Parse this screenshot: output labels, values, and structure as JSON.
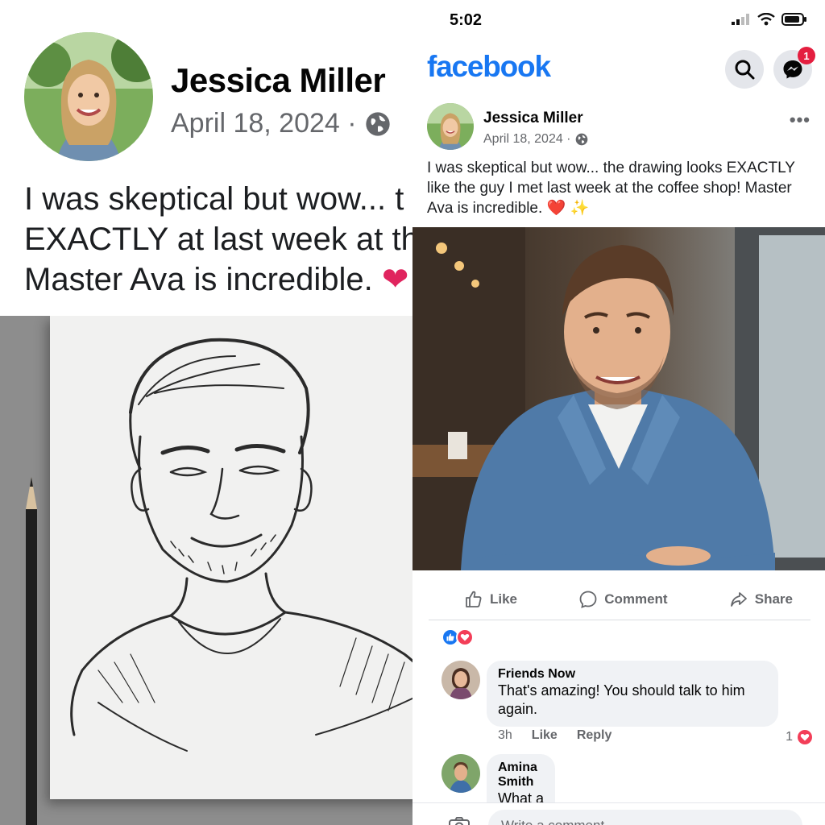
{
  "left_post": {
    "author": "Jessica Miller",
    "date": "April 18, 2024 ·",
    "text_lines": [
      "I was skeptical but wow... t",
      "EXACTLY at last week at th",
      "Master Ava is incredible."
    ]
  },
  "status_bar": {
    "time": "5:02"
  },
  "header": {
    "logo": "facebook",
    "messenger_badge": "1"
  },
  "post": {
    "author": "Jessica Miller",
    "date": "April 18, 2024 ·",
    "more": "•••",
    "text": "I was skeptical but wow... the drawing looks EXACTLY like the guy I met last week at the coffee shop! Master Ava is incredible. ❤️ ✨"
  },
  "actions": {
    "like": "Like",
    "comment": "Comment",
    "share": "Share"
  },
  "comments": [
    {
      "author": "Friends Now",
      "text": "That's amazing! You should talk to him again.",
      "time": "3h",
      "like": "Like",
      "reply": "Reply",
      "reaction_count": "1"
    },
    {
      "author": "Amina Smith",
      "text": "What a cool sketch!"
    }
  ],
  "composer": {
    "placeholder": "Write a comment..."
  },
  "colors": {
    "brand": "#1877f2",
    "secondary_text": "#65676b",
    "bubble": "#f0f2f5",
    "badge": "#e41e3f"
  }
}
